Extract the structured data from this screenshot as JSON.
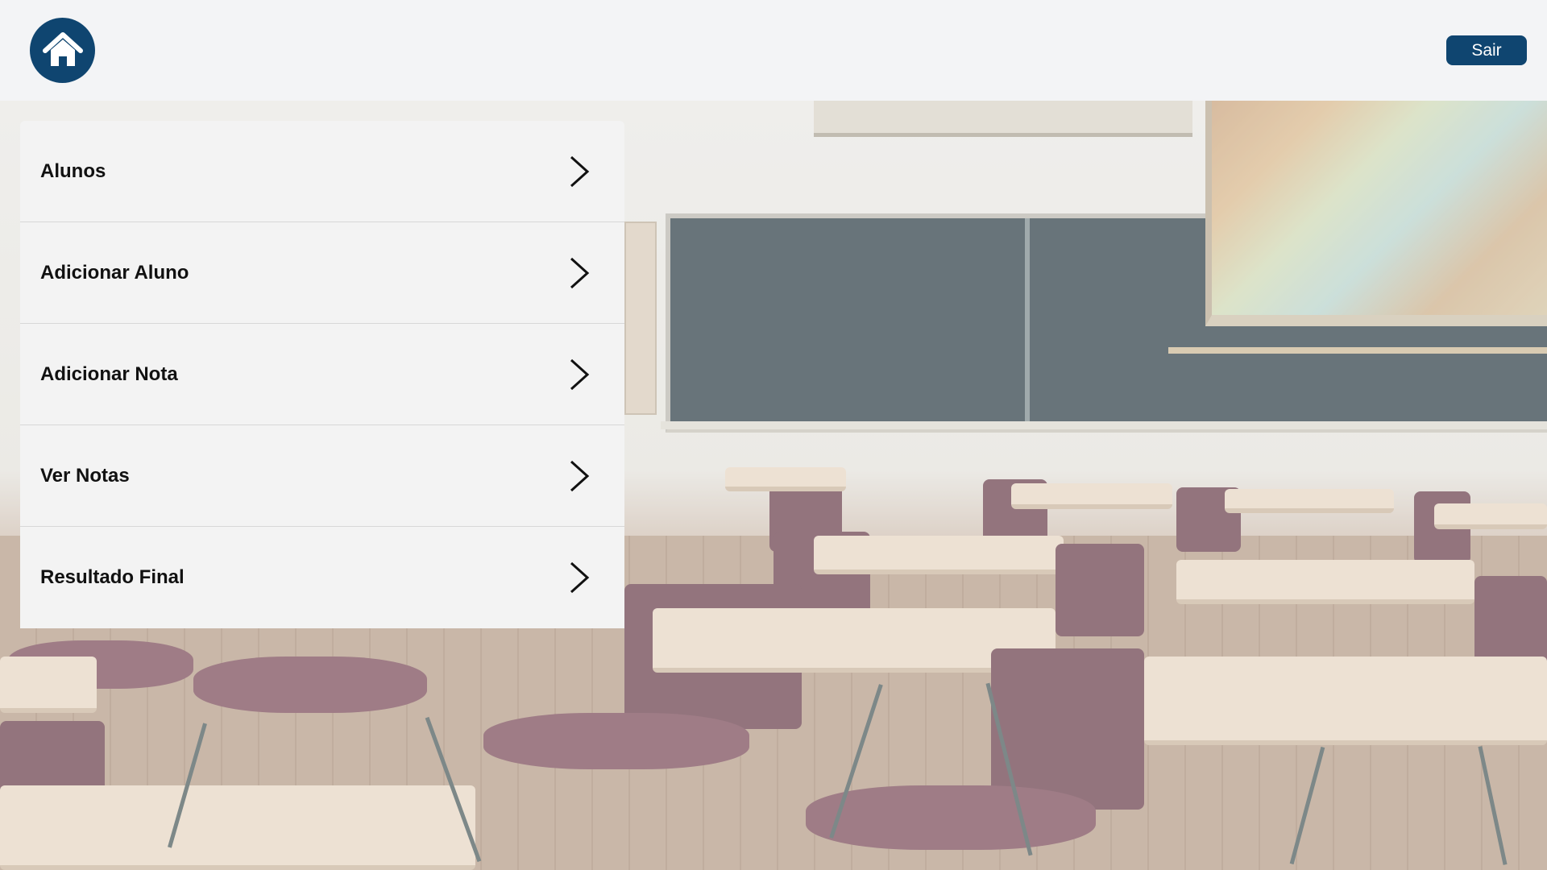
{
  "header": {
    "home_icon": "home-icon",
    "logout_label": "Sair"
  },
  "menu": {
    "items": [
      {
        "label": "Alunos",
        "icon": "chevron-right-icon"
      },
      {
        "label": "Adicionar Aluno",
        "icon": "chevron-right-icon"
      },
      {
        "label": "Adicionar Nota",
        "icon": "chevron-right-icon"
      },
      {
        "label": "Ver Notas",
        "icon": "chevron-right-icon"
      },
      {
        "label": "Resultado Final",
        "icon": "chevron-right-icon"
      }
    ]
  },
  "background": {
    "image": "classroom-photo"
  },
  "colors": {
    "primary": "#0f4570",
    "header_background": "#f3f4f6",
    "menu_background": "#f3f3f3",
    "menu_text": "#111111"
  }
}
